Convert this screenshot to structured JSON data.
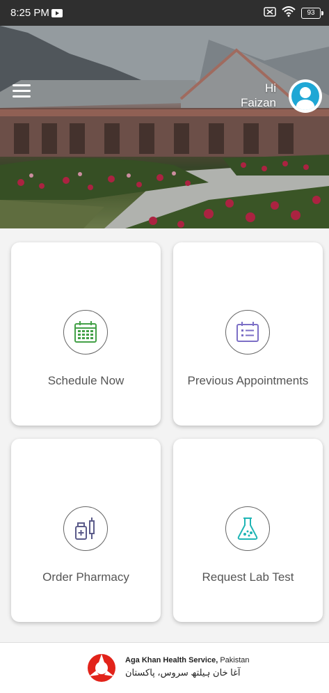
{
  "status_bar": {
    "time": "8:25 PM",
    "battery": "93"
  },
  "header": {
    "greeting": "Hi",
    "user_name": "Faizan"
  },
  "cards": [
    {
      "label": "Schedule Now",
      "icon": "calendar-icon",
      "color": "#43a047"
    },
    {
      "label": "Previous Appointments",
      "icon": "appointment-list-icon",
      "color": "#7c6fc6"
    },
    {
      "label": "Order Pharmacy",
      "icon": "pharmacy-icon",
      "color": "#5b5b8a"
    },
    {
      "label": "Request Lab Test",
      "icon": "lab-flask-icon",
      "color": "#1fb5b5"
    }
  ],
  "footer": {
    "brand_name": "Aga Khan Health Service,",
    "brand_country": " Pakistan",
    "brand_urdu": "آغا خان ہیلتھ سروس، پاکستان",
    "brand_color": "#e2231a"
  }
}
